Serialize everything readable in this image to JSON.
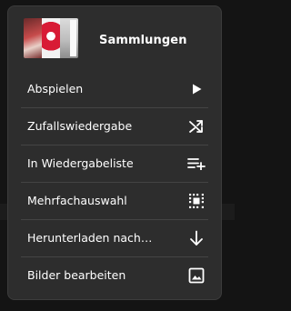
{
  "menu": {
    "header": {
      "title": "Sammlungen"
    },
    "items": [
      {
        "label": "Abspielen",
        "icon": "play-icon"
      },
      {
        "label": "Zufallswiedergabe",
        "icon": "shuffle-icon"
      },
      {
        "label": "In Wiedergabeliste",
        "icon": "add-to-queue-icon"
      },
      {
        "label": "Mehrfachauswahl",
        "icon": "multi-select-icon"
      },
      {
        "label": "Herunterladen nach…",
        "icon": "download-icon"
      },
      {
        "label": "Bilder bearbeiten",
        "icon": "image-icon"
      }
    ]
  },
  "colors": {
    "menu_background": "#2d2d2d",
    "text": "#ffffff",
    "divider": "#444444"
  }
}
